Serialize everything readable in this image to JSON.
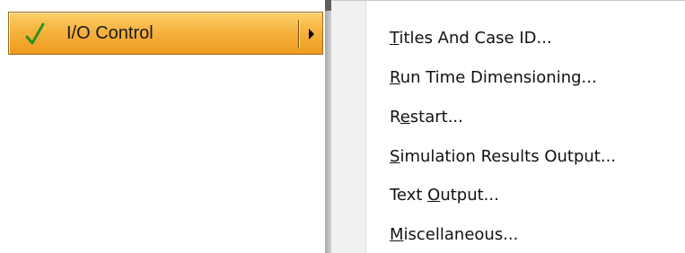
{
  "io_button": {
    "label": "I/O Control",
    "check_icon": "check-icon",
    "arrow_icon": "submenu-arrow-icon",
    "check_color": "#2f8f1d"
  },
  "submenu": {
    "items": [
      {
        "accel": "T",
        "rest": "itles And Case ID..."
      },
      {
        "accel": "R",
        "rest": "un Time Dimensioning..."
      },
      {
        "pre": "R",
        "accel": "e",
        "rest": "start..."
      },
      {
        "accel": "S",
        "rest": "imulation Results Output..."
      },
      {
        "pre": "Text ",
        "accel": "O",
        "rest": "utput..."
      },
      {
        "accel": "M",
        "rest": "iscellaneous..."
      }
    ]
  }
}
